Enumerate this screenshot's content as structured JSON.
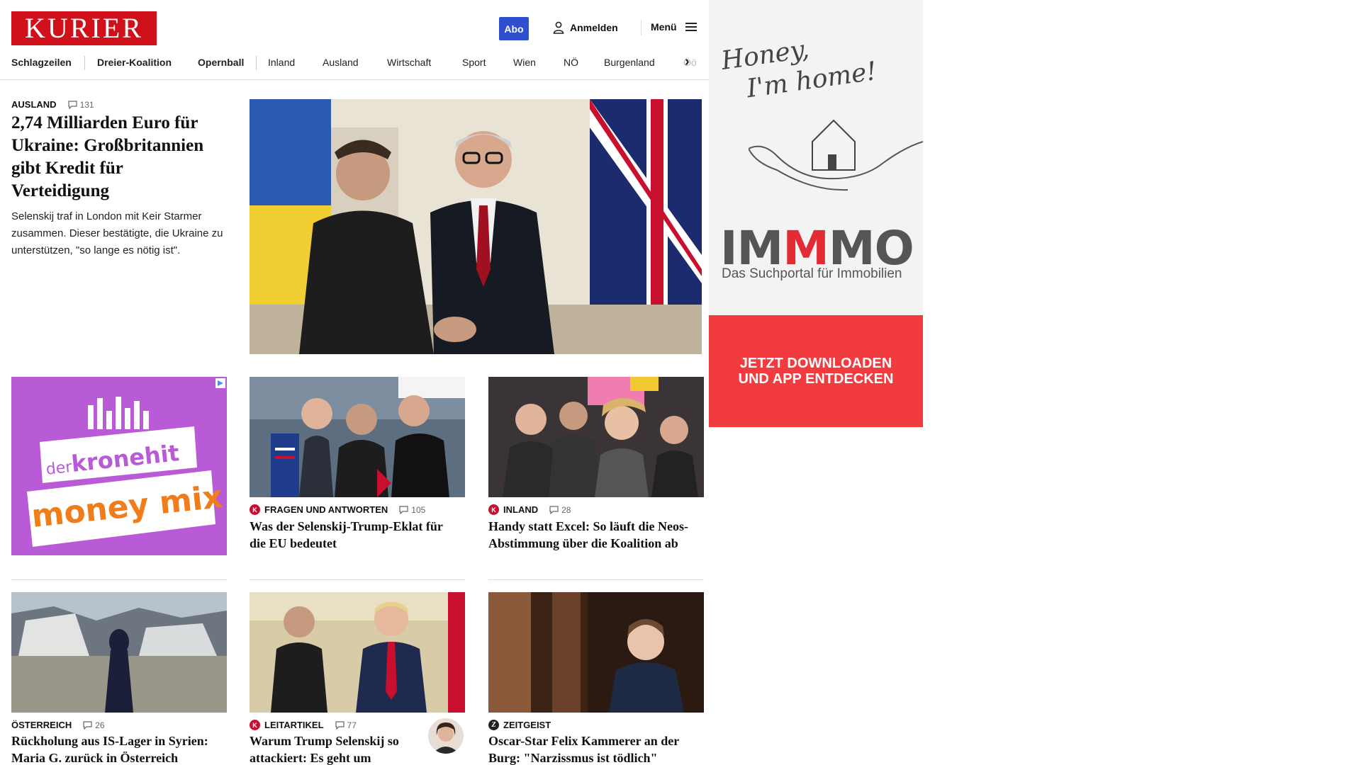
{
  "header": {
    "logo": "KURIER",
    "abo_label": "Abo",
    "login_label": "Anmelden",
    "menu_label": "Menü"
  },
  "nav": {
    "items": [
      "Schlagzeilen",
      "Dreier-Koalition",
      "Opernball",
      "Inland",
      "Ausland",
      "Wirtschaft",
      "Sport",
      "Wien",
      "NÖ",
      "Burgenland",
      "Öö"
    ]
  },
  "lead": {
    "kicker": "AUSLAND",
    "comments": "131",
    "title": "2,74 Milliarden Euro für Ukraine: Großbritannien gibt Kredit für Verteidigung",
    "teaser": "Selenskij traf in London mit Keir Starmer zusammen. Dieser bestätigte, die Ukraine zu unterstützen, \"so lange es nötig ist\"."
  },
  "promo": {
    "line1": "der",
    "line1b": "kronehit",
    "line2": "money mix"
  },
  "articles": [
    {
      "kicker": "FRAGEN UND ANTWORTEN",
      "comments": "105",
      "title": "Was der Selenskij-Trump-Eklat für die EU bedeutet"
    },
    {
      "kicker": "INLAND",
      "comments": "28",
      "title": "Handy statt Excel: So läuft die Neos-Abstimmung über die Koalition ab"
    },
    {
      "kicker": "ÖSTERREICH",
      "comments": "26",
      "title": "Rückholung aus IS-Lager in Syrien: Maria G. zurück in Österreich"
    },
    {
      "kicker": "LEITARTIKEL",
      "comments": "77",
      "title": "Warum Trump Selenskij so attackiert: Es geht um Dollars, nicht um Frieden"
    },
    {
      "kicker": "ZEITGEIST",
      "comments": "",
      "title": "Oscar-Star Felix Kammerer an der Burg: \"Narzissmus ist tödlich\""
    }
  ],
  "ad": {
    "tagline1": "Honey,",
    "tagline2": "I'm home!",
    "brand_a": "IM",
    "brand_b": "M",
    "brand_c": "MO",
    "subtitle": "Das Suchportal für Immobilien",
    "cta_line1": "JETZT DOWNLOADEN",
    "cta_line2": "UND APP ENTDECKEN"
  },
  "colors": {
    "brand": "#d0111b",
    "abo": "#2f4fd0",
    "promo": "#b95ad6",
    "ad_cta": "#f23b3f"
  }
}
